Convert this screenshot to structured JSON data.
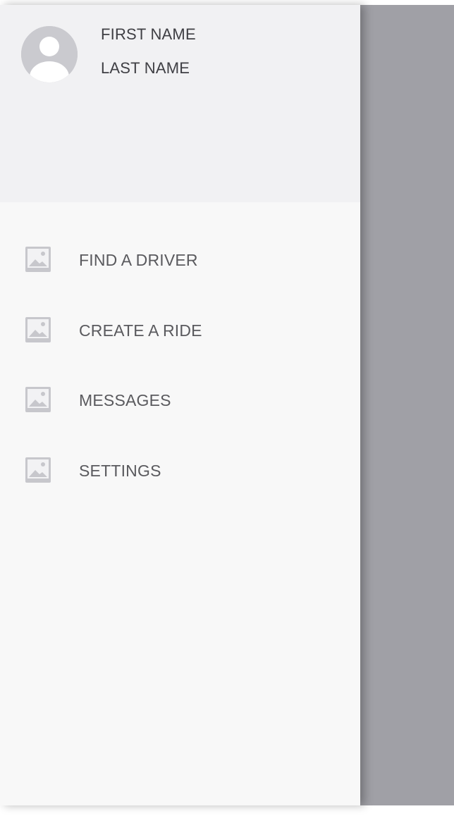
{
  "profile": {
    "first_name": "FIRST NAME",
    "last_name": "LAST NAME",
    "avatar_icon": "user-avatar-placeholder-icon"
  },
  "menu": {
    "items": [
      {
        "label": "FIND A DRIVER",
        "icon": "image-placeholder-icon"
      },
      {
        "label": "CREATE A RIDE",
        "icon": "image-placeholder-icon"
      },
      {
        "label": "MESSAGES",
        "icon": "image-placeholder-icon"
      },
      {
        "label": "SETTINGS",
        "icon": "image-placeholder-icon"
      }
    ]
  },
  "colors": {
    "overlay": "#a0a0a6",
    "drawer_background": "#f8f8f8",
    "header_background": "#f1f1f3",
    "icon_gray": "#c7c7cc",
    "text": "#5a5a5e"
  }
}
